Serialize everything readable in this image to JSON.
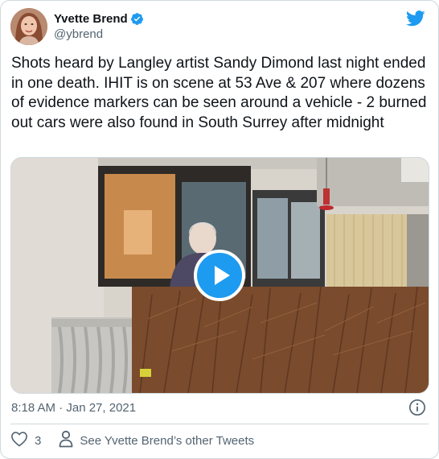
{
  "author": {
    "display_name": "Yvette Brend",
    "handle": "@ybrend",
    "verified": true
  },
  "tweet": {
    "text": "Shots heard by Langley artist Sandy Dimond last night ended in one death. IHIT is on scene at 53 Ave & 207 where dozens of evidence markers can be seen around a vehicle - 2 burned out cars were also found in South Surrey after midnight",
    "timestamp": "8:18 AM · Jan 27, 2021"
  },
  "actions": {
    "like_count": "3",
    "see_others_label": "See Yvette Brend’s other Tweets"
  },
  "icons": {
    "logo": "twitter-bird-icon",
    "verified": "verified-badge-icon",
    "info": "info-icon",
    "like": "heart-icon",
    "profile": "person-icon",
    "play": "play-icon"
  },
  "colors": {
    "accent": "#1d9bf0",
    "text": "#0f1419",
    "secondary_text": "#536471",
    "border": "#cfd9de"
  }
}
